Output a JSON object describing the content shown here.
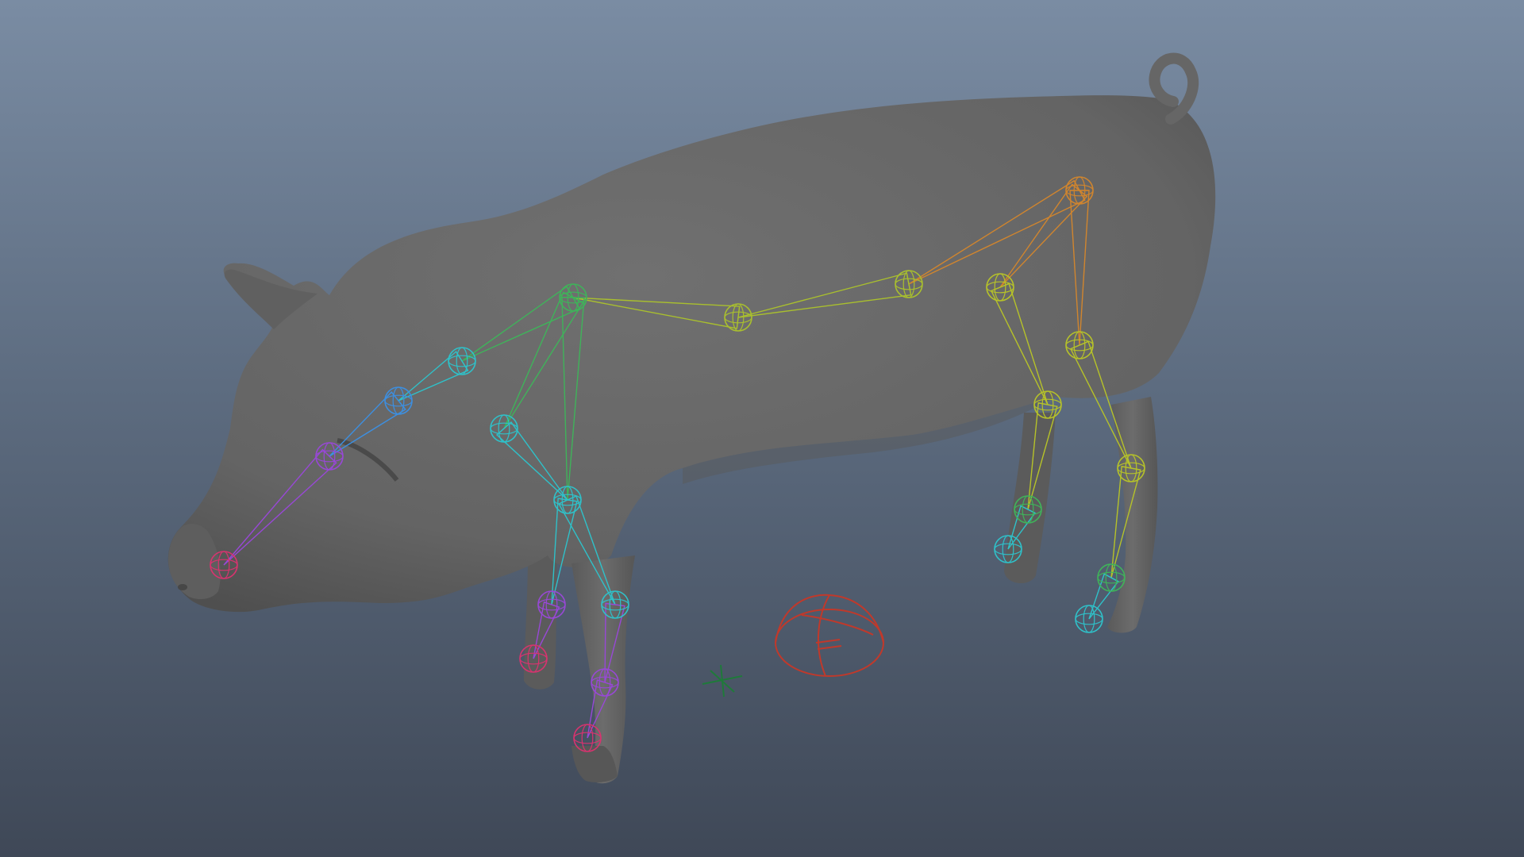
{
  "viewport": {
    "background_top": "#7a8ca3",
    "background_bottom": "#3f4857"
  },
  "model": {
    "mesh_color": "#6b6b6b",
    "mesh_shade": "#555555"
  },
  "rig": {
    "colors": {
      "spine_lower": "#a9bf2e",
      "pelvis": "#d0852e",
      "shoulder": "#3fb35a",
      "neck": "#2fc1c9",
      "neck_upper": "#3d8fe0",
      "head": "#9848d6",
      "snout": "#d8336f",
      "hind_leg": "#b6c229",
      "hind_foot": "#2fc1c9",
      "front_leg": "#2fc1c9",
      "front_foot": "#9848d6",
      "front_toe": "#d8336f",
      "root_control": "#c0392b",
      "locator": "#1f7a3a"
    }
  }
}
